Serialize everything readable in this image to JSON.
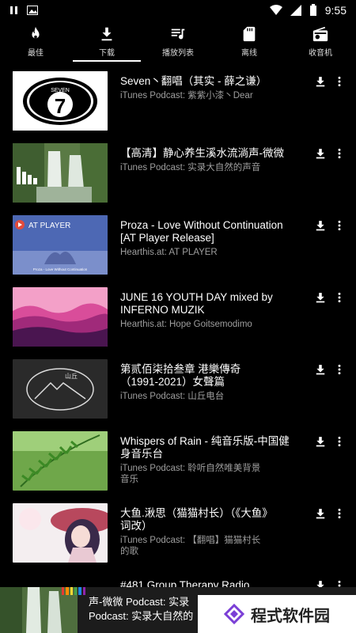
{
  "status": {
    "time": "9:55"
  },
  "tabs": [
    {
      "label": "最佳",
      "icon": "flame-icon"
    },
    {
      "label": "下载",
      "icon": "download-icon",
      "active": true
    },
    {
      "label": "播放列表",
      "icon": "playlist-icon"
    },
    {
      "label": "离线",
      "icon": "sd-card-icon"
    },
    {
      "label": "收音机",
      "icon": "radio-icon"
    }
  ],
  "episodes": [
    {
      "title_l1": "Seven丶翻唱（其实 - 薛之谦）",
      "title_l2": "",
      "sub_l1": "iTunes Podcast: 紫紫小漆丶Dear",
      "sub_l2": ""
    },
    {
      "title_l1": "【高清】静心养生溪水流淌声-微微",
      "title_l2": "",
      "sub_l1": "iTunes Podcast: 实录大自然的声音",
      "sub_l2": ""
    },
    {
      "title_l1": "Proza - Love Without Continuation",
      "title_l2": "[AT Player Release]",
      "sub_l1": "Hearthis.at: AT PLAYER",
      "sub_l2": ""
    },
    {
      "title_l1": "JUNE 16 YOUTH DAY mixed by",
      "title_l2": "INFERNO MUZIK",
      "sub_l1": "Hearthis.at: Hope Goitsemodimo",
      "sub_l2": ""
    },
    {
      "title_l1": "第贰佰柒拾叁章 港樂傳奇",
      "title_l2": "（1991-2021）女聲篇",
      "sub_l1": "iTunes Podcast: 山丘电台",
      "sub_l2": ""
    },
    {
      "title_l1": "Whispers of Rain - 纯音乐版-中国健",
      "title_l2": "身音乐台",
      "sub_l1": "iTunes Podcast: 聆听自然唯美背景",
      "sub_l2": "音乐"
    },
    {
      "title_l1": "大鱼.湫思（猫猫村长）（《大鱼》",
      "title_l2": "词改）",
      "sub_l1": "iTunes Podcast: 【翻唱】猫猫村长",
      "sub_l2": "的歌"
    },
    {
      "title_l1": "#481 Group Therapy Radio",
      "title_l2": "",
      "sub_l1": "",
      "sub_l2": ""
    }
  ],
  "thumbs": {
    "seven_logo_top": "SEVEN",
    "seven_logo_num": "7",
    "at_player": "AT PLAYER",
    "at_caption": "Proza - Love Without Continuation",
    "mountain_text": "山丘"
  },
  "mini_player": {
    "line1": "声-微微 Podcast: 实录",
    "line2": "Podcast: 实录大自然的"
  },
  "watermark": {
    "text": "程式软件园"
  }
}
